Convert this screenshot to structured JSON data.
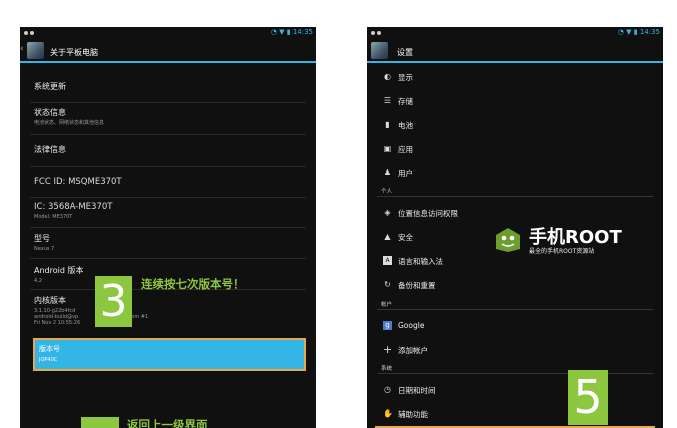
{
  "left": {
    "status_time": "14:35",
    "title": "关于平板电脑",
    "items": [
      {
        "title": "系统更新",
        "sub": ""
      },
      {
        "title": "状态信息",
        "sub": "电池状态、网络状态和其他信息"
      },
      {
        "title": "法律信息",
        "sub": ""
      },
      {
        "title": "FCC ID: MSQME370T",
        "sub": ""
      },
      {
        "title": "IC: 3568A-ME370T",
        "sub": "Model: ME370T"
      },
      {
        "title": "型号",
        "sub": "Nexus 7"
      },
      {
        "title": "Android 版本",
        "sub": "4.2"
      },
      {
        "title": "内核版本",
        "sub": "3.1.10-g22b4fcd\nandroid-build@vp                    google.com #1\nFri Nov 2 10:55:26"
      }
    ],
    "highlight": {
      "title": "版本号",
      "sub": "JOP40C"
    },
    "step3": {
      "number": "3",
      "text": "连续按七次版本号！"
    },
    "step4": {
      "text": "返回上一级界面"
    }
  },
  "right": {
    "status_time": "14:35",
    "title": "设置",
    "items": [
      {
        "icon": "brightness-icon",
        "glyph": "◐",
        "label": "显示"
      },
      {
        "icon": "storage-icon",
        "glyph": "☰",
        "label": "存储"
      },
      {
        "icon": "battery-icon",
        "glyph": "▮",
        "label": "电池"
      },
      {
        "icon": "apps-icon",
        "glyph": "▣",
        "label": "应用"
      },
      {
        "icon": "user-icon",
        "glyph": "♟",
        "label": "用户"
      }
    ],
    "section_personal": "个人",
    "items_personal": [
      {
        "icon": "location-icon",
        "glyph": "◈",
        "label": "位置信息访问权限"
      },
      {
        "icon": "lock-icon",
        "glyph": "▲",
        "label": "安全"
      },
      {
        "icon": "language-icon",
        "glyph": "A",
        "label": "语言和输入法"
      },
      {
        "icon": "backup-icon",
        "glyph": "↻",
        "label": "备份和重置"
      }
    ],
    "section_accounts": "帐户",
    "items_accounts": [
      {
        "icon": "google-icon",
        "glyph": "g",
        "label": "Google"
      },
      {
        "icon": "plus-icon",
        "glyph": "+",
        "label": "添加帐户"
      }
    ],
    "section_system": "系统",
    "items_system": [
      {
        "icon": "clock-icon",
        "glyph": "◷",
        "label": "日期和时间"
      },
      {
        "icon": "accessibility-icon",
        "glyph": "✋",
        "label": "辅助功能"
      }
    ],
    "step5": {
      "number": "5"
    },
    "watermark": {
      "title": "手机ROOT",
      "sub": "最全的手机ROOT资源站"
    }
  },
  "colors": {
    "accent": "#33b5e5",
    "step": "#8dc63f",
    "outline": "#e8a84b"
  }
}
